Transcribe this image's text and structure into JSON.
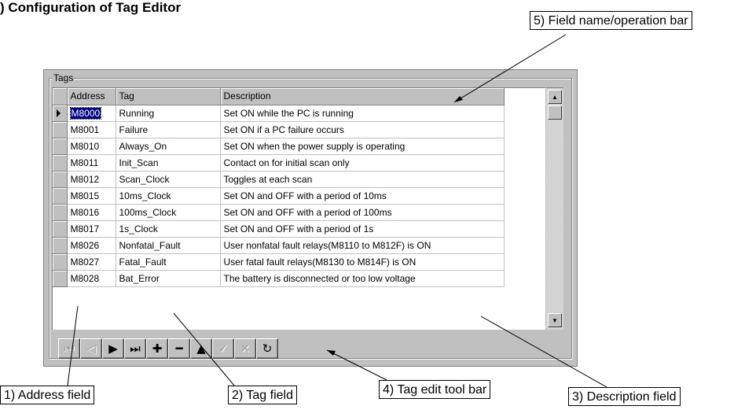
{
  "heading": ") Configuration of Tag Editor",
  "group_label": "Tags",
  "columns": {
    "address": "Address",
    "tag": "Tag",
    "description": "Description"
  },
  "rows": [
    {
      "address": "M8000",
      "tag": "Running",
      "description": "Set ON while the PC is running"
    },
    {
      "address": "M8001",
      "tag": "Failure",
      "description": "Set ON if a PC failure occurs"
    },
    {
      "address": "M8010",
      "tag": "Always_On",
      "description": "Set ON when the power supply is operating"
    },
    {
      "address": "M8011",
      "tag": "Init_Scan",
      "description": "Contact on for initial scan only"
    },
    {
      "address": "M8012",
      "tag": "Scan_Clock",
      "description": "Toggles at each scan"
    },
    {
      "address": "M8015",
      "tag": "10ms_Clock",
      "description": "Set ON and OFF with a period of 10ms"
    },
    {
      "address": "M8016",
      "tag": "100ms_Clock",
      "description": "Set ON and OFF with a period of 100ms"
    },
    {
      "address": "M8017",
      "tag": "1s_Clock",
      "description": "Set ON and OFF with a period of 1s"
    },
    {
      "address": "M8026",
      "tag": "Nonfatal_Fault",
      "description": "User nonfatal fault relays(M8110 to M812F) is ON"
    },
    {
      "address": "M8027",
      "tag": "Fatal_Fault",
      "description": "User fatal fault relays(M8130 to M814F) is ON"
    },
    {
      "address": "M8028",
      "tag": "Bat_Error",
      "description": "The battery is disconnected or too low voltage"
    }
  ],
  "toolbar": {
    "first": "⏮",
    "prev": "◁",
    "next": "▶",
    "last": "⏭",
    "add": "✚",
    "remove": "━",
    "up": "▲",
    "ok": "✓",
    "cancel": "✕",
    "refresh": "↻"
  },
  "callouts": {
    "field_bar": "5) Field name/operation bar",
    "address": "1) Address field",
    "tag": "2) Tag field",
    "toolbar": "4) Tag edit tool bar",
    "description": "3) Description field"
  }
}
